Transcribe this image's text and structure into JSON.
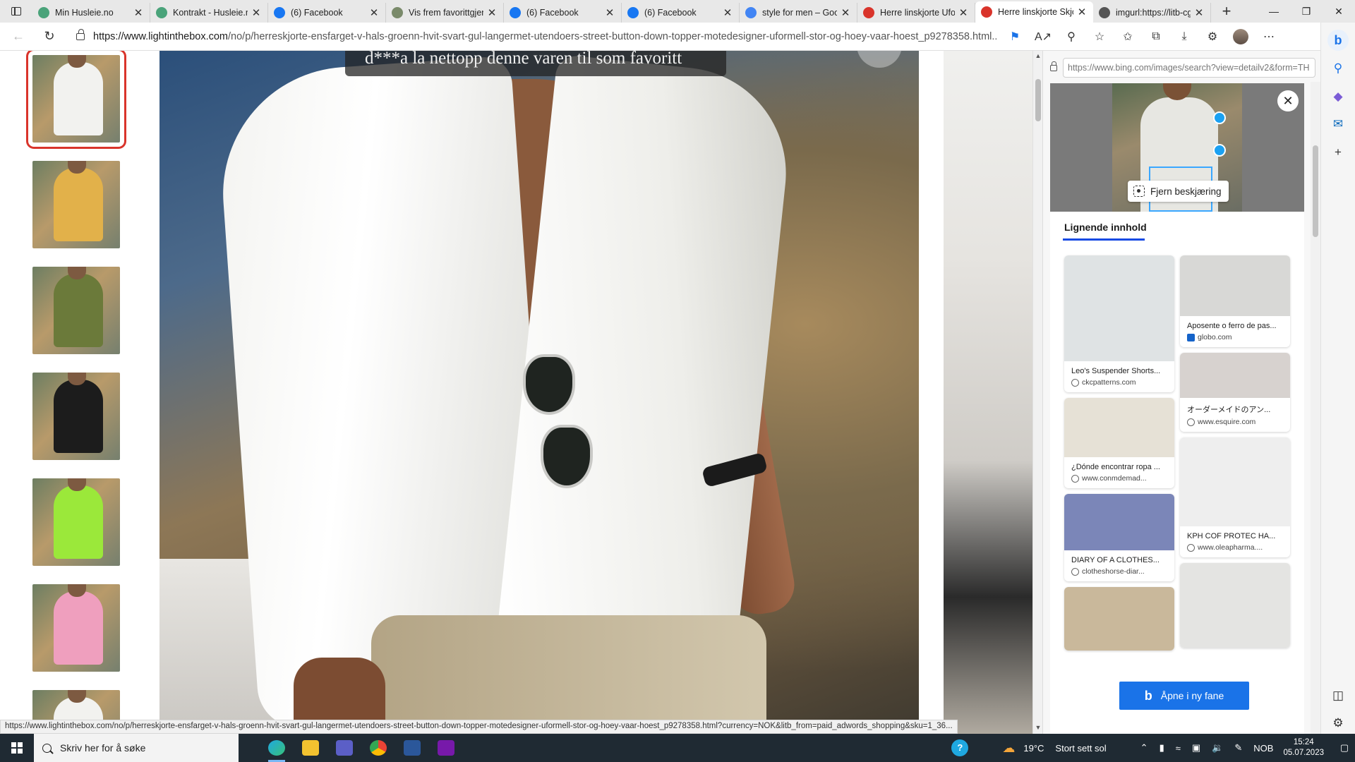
{
  "browser": {
    "tabs": [
      {
        "title": "Min Husleie.no",
        "favicon": "husleie-icon",
        "color": "#4aa37a",
        "active": false
      },
      {
        "title": "Kontrakt - Husleie.no",
        "favicon": "husleie-icon",
        "color": "#4aa37a",
        "active": false
      },
      {
        "title": "(6) Facebook",
        "favicon": "facebook-icon",
        "color": "#1877f2",
        "active": false
      },
      {
        "title": "Vis frem favorittgjenstander",
        "favicon": "generic-page-icon",
        "color": "#7a8a6a",
        "active": false
      },
      {
        "title": "(6) Facebook",
        "favicon": "facebook-icon",
        "color": "#1877f2",
        "active": false
      },
      {
        "title": "(6) Facebook",
        "favicon": "facebook-icon",
        "color": "#1877f2",
        "active": false
      },
      {
        "title": "style for men – Google",
        "favicon": "google-icon",
        "color": "#4285f4",
        "active": false
      },
      {
        "title": "Herre linskjorte Ufo",
        "favicon": "lightinthebox-icon",
        "color": "#d9342b",
        "active": false
      },
      {
        "title": "Herre linskjorte Skjorte",
        "favicon": "lightinthebox-icon",
        "color": "#d9342b",
        "active": true
      },
      {
        "title": "imgurl:https://litb-cgis",
        "favicon": "bing-search-icon",
        "color": "#555555",
        "active": false
      }
    ],
    "address": {
      "host": "https://www.lightinthebox.com",
      "path": "/no/p/herreskjorte-ensfarget-v-hals-groenn-hvit-svart-gul-langermet-utendoers-street-button-down-topper-motedesigner-uformell-stor-og-hoey-vaar-hoest_p9278358.html..."
    },
    "status_url": "https://www.lightinthebox.com/no/p/herreskjorte-ensfarget-v-hals-groenn-hvit-svart-gul-langermet-utendoers-street-button-down-topper-motedesigner-uformell-stor-og-hoey-vaar-hoest_p9278358.html?currency=NOK&litb_from=paid_adwords_shopping&sku=1_36..."
  },
  "product": {
    "banner_text": "d***a la nettopp denne varen til som favoritt",
    "thumbnails": [
      {
        "color_name": "white",
        "color": "#f2f2ef",
        "selected": true
      },
      {
        "color_name": "yellow",
        "color": "#e2b14a",
        "selected": false
      },
      {
        "color_name": "green",
        "color": "#6b7a3a",
        "selected": false
      },
      {
        "color_name": "black",
        "color": "#1c1c1c",
        "selected": false
      },
      {
        "color_name": "lime",
        "color": "#9be83a",
        "selected": false
      },
      {
        "color_name": "pink",
        "color": "#ef9fbe",
        "selected": false
      },
      {
        "color_name": "white",
        "color": "#f2f2ef",
        "selected": false
      }
    ]
  },
  "visual_search": {
    "url": "https://www.bing.com/images/search?view=detailv2&form=TH",
    "remove_crop_label": "Fjern beskjæring",
    "tab_label": "Lignende innhold",
    "open_in_new_tab_label": "Åpne i ny fane",
    "results_left": [
      {
        "caption": "Leo's Suspender Shorts...",
        "source": "ckcpatterns.com",
        "img_color": "#dfe3e4",
        "img_h": 150
      },
      {
        "caption": "¿Dónde encontrar ropa ...",
        "source": "www.conmdemad...",
        "img_color": "#e6e1d6",
        "img_h": 84
      },
      {
        "caption": "DIARY OF A CLOTHES...",
        "source": "clotheshorse-diar...",
        "img_color": "#7b86b8",
        "img_h": 80
      },
      {
        "caption": "",
        "source": "",
        "img_color": "#c9b89b",
        "img_h": 90
      }
    ],
    "results_right": [
      {
        "caption": "Aposente o ferro de pas...",
        "source": "globo.com",
        "source_icon": "globo-icon",
        "img_color": "#d8d8d6",
        "img_h": 86
      },
      {
        "caption": "オーダーメイドのアン...",
        "source": "www.esquire.com",
        "img_color": "#d7d2cf",
        "img_h": 64
      },
      {
        "caption": "KPH COF PROTEC HA...",
        "source": "www.oleapharma....",
        "img_color": "#eeeeee",
        "img_h": 126
      },
      {
        "caption": "",
        "source": "",
        "img_color": "#e4e4e2",
        "img_h": 120
      }
    ]
  },
  "taskbar": {
    "search_placeholder": "Skriv her for å søke",
    "weather": "19°C",
    "weather_desc": "Stort sett sol",
    "language": "NOB",
    "time": "15:24",
    "date": "05.07.2023"
  }
}
